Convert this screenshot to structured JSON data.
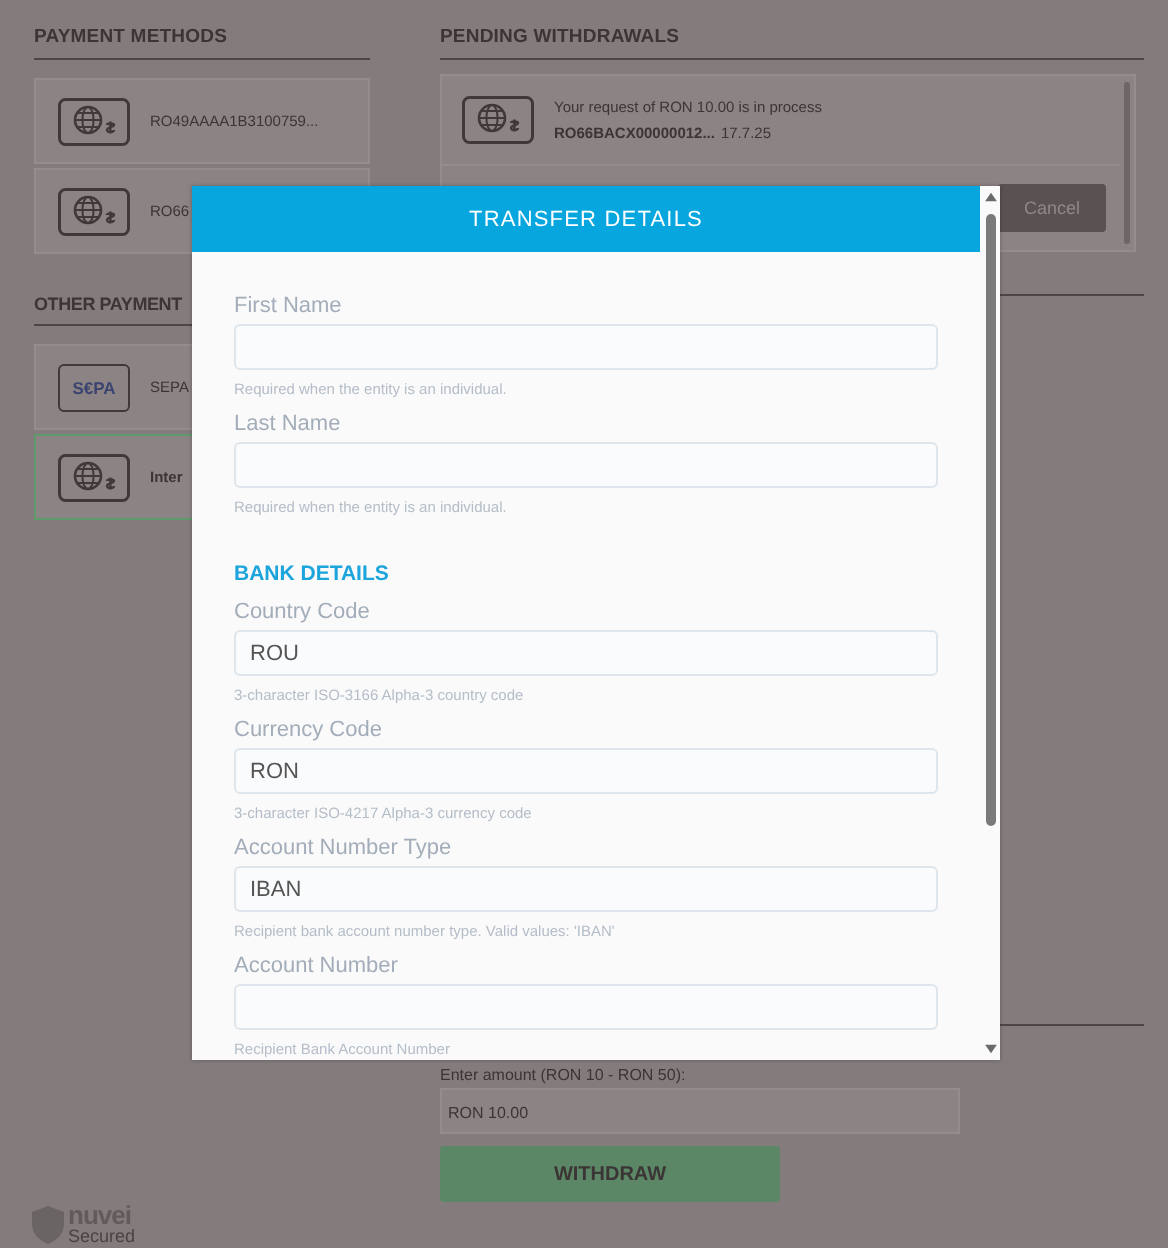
{
  "payment_methods": {
    "title": "PAYMENT METHODS",
    "items": [
      {
        "kind": "bank",
        "text": "RO49AAAA1B3100759...",
        "selected": false
      },
      {
        "kind": "bank",
        "text": "RO66",
        "selected": false
      }
    ]
  },
  "other_payment_methods": {
    "title": "OTHER PAYMENT",
    "items": [
      {
        "kind": "sepa",
        "logo": "S€PA",
        "text": "SEPA",
        "selected": false
      },
      {
        "kind": "bank",
        "text": "Inter",
        "selected": true
      }
    ]
  },
  "pending_withdrawals": {
    "title": "PENDING WITHDRAWALS",
    "items": [
      {
        "message": "Your request of RON 10.00 is in process",
        "account": "RO66BACX00000012...",
        "date": "17.7.25",
        "button": "Cancel"
      }
    ]
  },
  "withdraw": {
    "label": "Enter amount (RON 10 - RON 50):",
    "amount": "RON 10.00",
    "button": "WITHDRAW"
  },
  "brand": {
    "name": "nuvei",
    "tagline": "Secured"
  },
  "modal": {
    "title": "TRANSFER DETAILS",
    "items": [
      {
        "kind": "field",
        "label": "First Name",
        "hint": "Required when the entity is an individual."
      },
      {
        "kind": "field",
        "label": "Last Name",
        "hint": "Required when the entity is an individual."
      },
      {
        "kind": "section",
        "label": "BANK DETAILS"
      },
      {
        "kind": "field",
        "label": "Country Code",
        "value": "ROU",
        "hint": "3-character ISO-3166 Alpha-3 country code"
      },
      {
        "kind": "field",
        "label": "Currency Code",
        "value": "RON",
        "hint": "3-character ISO-4217 Alpha-3 currency code"
      },
      {
        "kind": "field",
        "label": "Account Number Type",
        "value": "IBAN",
        "hint": "Recipient bank account number type. Valid values: 'IBAN'"
      },
      {
        "kind": "field",
        "label": "Account Number",
        "hint": "Recipient Bank Account Number"
      }
    ]
  }
}
